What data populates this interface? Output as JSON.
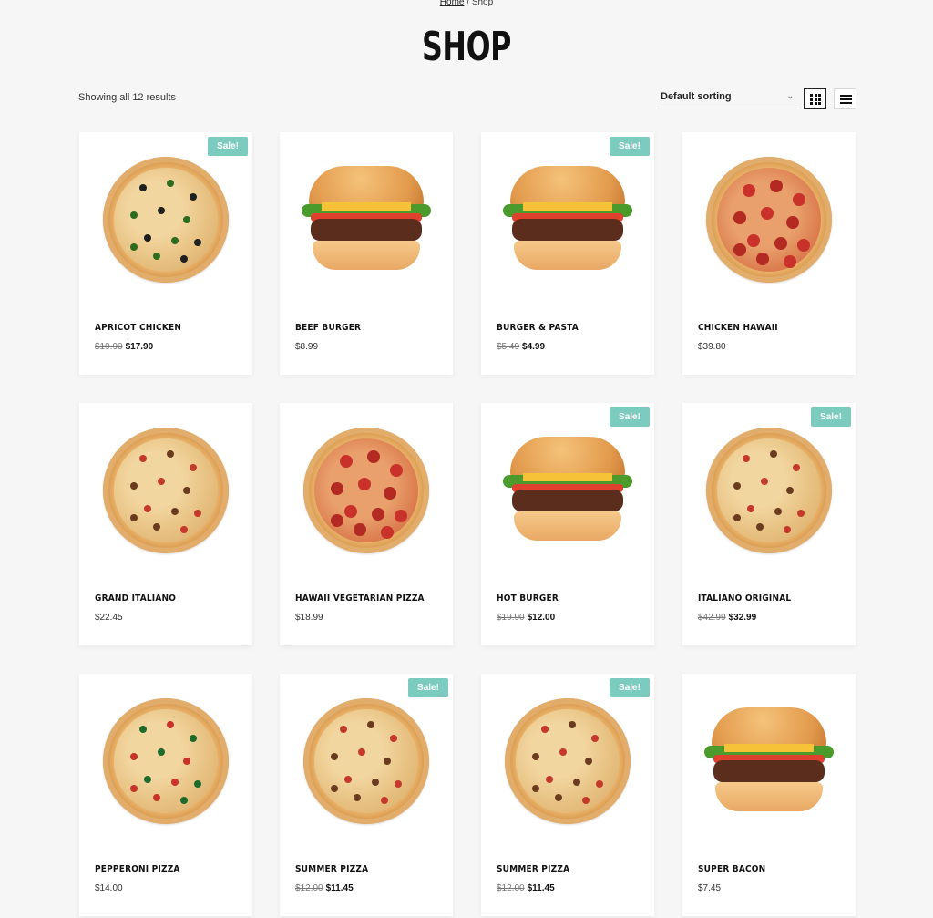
{
  "breadcrumb": {
    "home": "Home",
    "sep": " / ",
    "current": "Shop"
  },
  "page_title": "SHOP",
  "results_text": "Showing all 12 results",
  "sorting": {
    "selected": "Default sorting"
  },
  "view": {
    "active": "grid"
  },
  "colors": {
    "sale_badge": "#7ccbbf",
    "background": "#f7f6f6"
  },
  "products": [
    {
      "name": "APRICOT CHICKEN",
      "old_price": "$19.90",
      "price": "$17.90",
      "sale": "Sale!",
      "image": "pizza-olive-icon"
    },
    {
      "name": "BEEF BURGER",
      "old_price": "",
      "price": "$8.99",
      "sale": "",
      "image": "burger-icon"
    },
    {
      "name": "BURGER & PASTA",
      "old_price": "$5.49",
      "price": "$4.99",
      "sale": "Sale!",
      "image": "burger-icon"
    },
    {
      "name": "CHICKEN HAWAII",
      "old_price": "",
      "price": "$39.80",
      "sale": "",
      "image": "pizza-pepperoni-icon"
    },
    {
      "name": "GRAND ITALIANO",
      "old_price": "",
      "price": "$22.45",
      "sale": "",
      "image": "pizza-icon"
    },
    {
      "name": "HAWAII VEGETARIAN PIZZA",
      "old_price": "",
      "price": "$18.99",
      "sale": "",
      "image": "pizza-pepperoni-icon"
    },
    {
      "name": "HOT BURGER",
      "old_price": "$19.90",
      "price": "$12.00",
      "sale": "Sale!",
      "image": "burger-icon"
    },
    {
      "name": "ITALIANO ORIGINAL",
      "old_price": "$42.99",
      "price": "$32.99",
      "sale": "Sale!",
      "image": "pizza-icon"
    },
    {
      "name": "PEPPERONI PIZZA",
      "old_price": "",
      "price": "$14.00",
      "sale": "",
      "image": "pizza-arugula-icon"
    },
    {
      "name": "SUMMER PIZZA",
      "old_price": "$12.00",
      "price": "$11.45",
      "sale": "Sale!",
      "image": "pizza-icon"
    },
    {
      "name": "SUMMER PIZZA",
      "old_price": "$12.00",
      "price": "$11.45",
      "sale": "Sale!",
      "image": "pizza-icon"
    },
    {
      "name": "SUPER BACON",
      "old_price": "",
      "price": "$7.45",
      "sale": "",
      "image": "burger-icon"
    }
  ]
}
